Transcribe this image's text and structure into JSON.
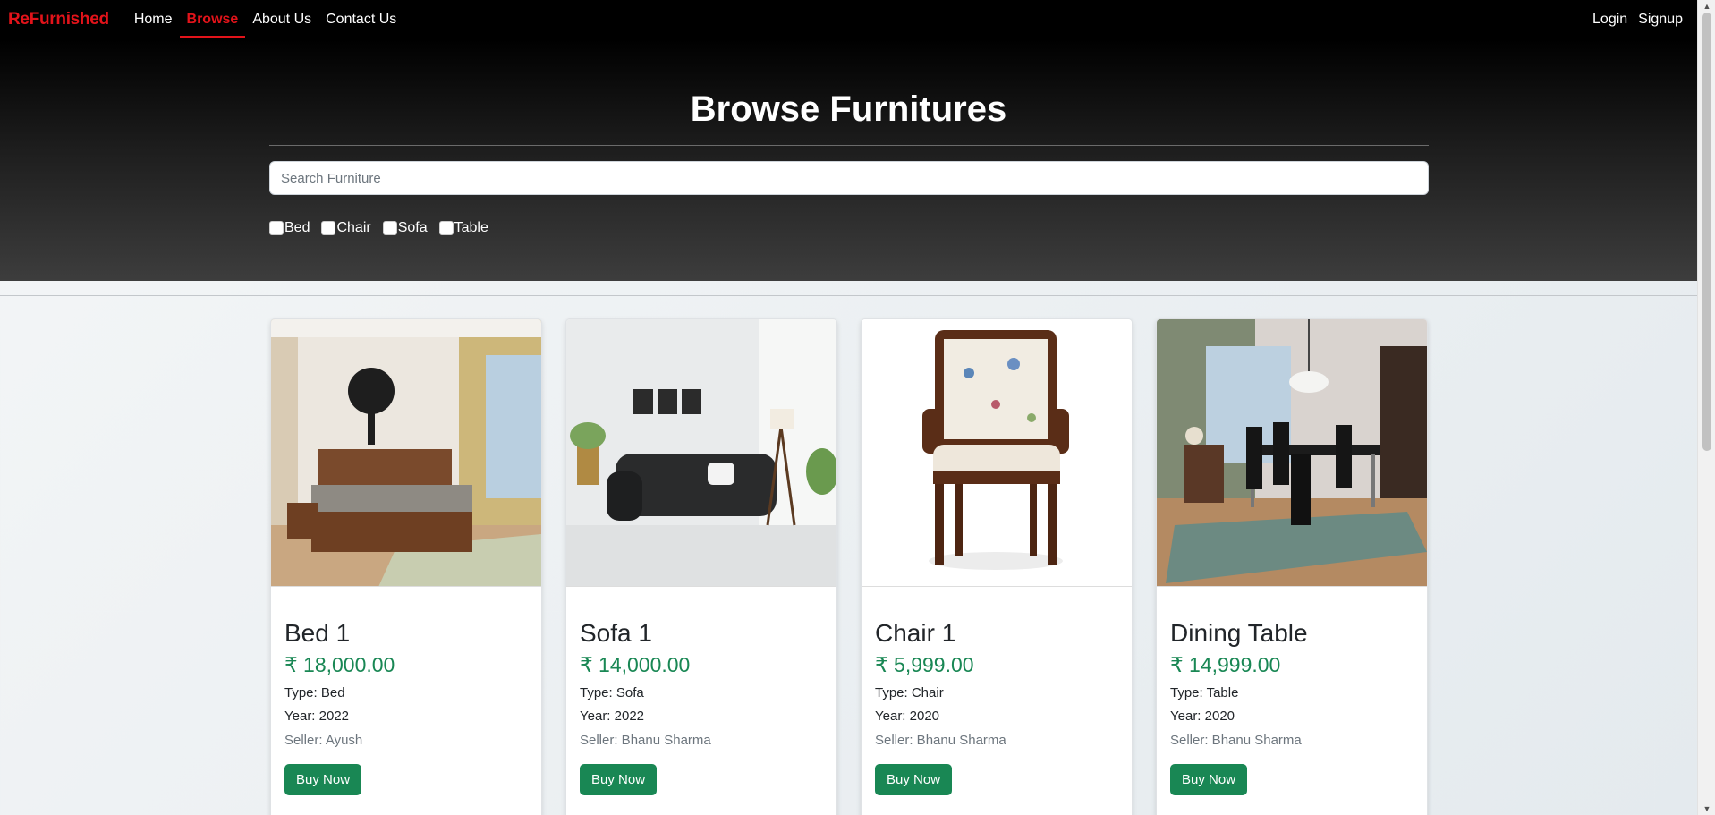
{
  "nav": {
    "brand": "ReFurnished",
    "links": [
      "Home",
      "Browse",
      "About Us",
      "Contact Us"
    ],
    "active": "Browse",
    "right_links": [
      "Login",
      "Signup"
    ]
  },
  "hero": {
    "title": "Browse Furnitures",
    "search_placeholder": "Search Furniture",
    "filters": [
      "Bed",
      "Chair",
      "Sofa",
      "Table"
    ]
  },
  "products": [
    {
      "title": "Bed 1",
      "price": "₹ 18,000.00",
      "type": "Type: Bed",
      "year": "Year: 2022",
      "seller": "Seller: Ayush",
      "button": "Buy Now",
      "image": "bed-photo"
    },
    {
      "title": "Sofa 1",
      "price": "₹ 14,000.00",
      "type": "Type: Sofa",
      "year": "Year: 2022",
      "seller": "Seller: Bhanu Sharma",
      "button": "Buy Now",
      "image": "sofa-photo"
    },
    {
      "title": "Chair 1",
      "price": "₹ 5,999.00",
      "type": "Type: Chair",
      "year": "Year: 2020",
      "seller": "Seller: Bhanu Sharma",
      "button": "Buy Now",
      "image": "chair-photo"
    },
    {
      "title": "Dining Table",
      "price": "₹ 14,999.00",
      "type": "Type: Table",
      "year": "Year: 2020",
      "seller": "Seller: Bhanu Sharma",
      "button": "Buy Now",
      "image": "dining-table-photo"
    }
  ],
  "colors": {
    "brand": "#e2131a",
    "price": "#198754",
    "button": "#198754",
    "navbar": "#000000"
  }
}
